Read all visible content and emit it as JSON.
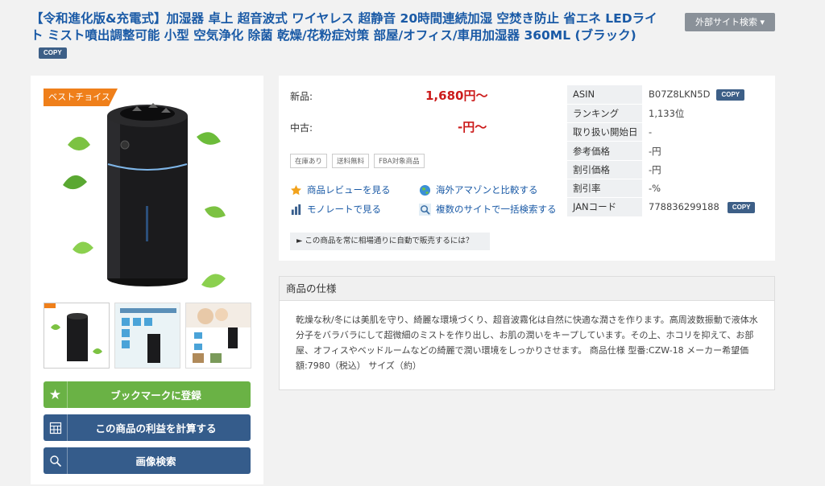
{
  "title": "【令和進化版&充電式】加湿器 卓上 超音波式 ワイヤレス 超静音 20時間連続加湿 空焚き防止 省エネ LEDライト ミスト噴出調整可能 小型 空気浄化 除菌 乾燥/花粉症対策 部屋/オフィス/車用加湿器 360ML (ブラック)",
  "copy_label": "COPY",
  "external_search": "外部サイト検索 ▾",
  "ribbon": "ベストチョイス",
  "buttons": {
    "bookmark": "ブックマークに登録",
    "profit": "この商品の利益を計算する",
    "image_search": "画像検索"
  },
  "price": {
    "new_label": "新品:",
    "new_value": "1,680円〜",
    "used_label": "中古:",
    "used_value": "-円〜"
  },
  "tags": [
    "在庫あり",
    "送料無料",
    "FBA対象商品"
  ],
  "links": {
    "review": "商品レビューを見る",
    "overseas": "海外アマゾンと比較する",
    "monorate": "モノレートで見る",
    "multi_search": "複数のサイトで一括検索する"
  },
  "howto": "►  この商品を常に相場通りに自動で販売するには？",
  "info": [
    {
      "key": "ASIN",
      "value": "B07Z8LKN5D"
    },
    {
      "key": "ランキング",
      "value": "1,133位"
    },
    {
      "key": "取り扱い開始日",
      "value": "-"
    },
    {
      "key": "参考価格",
      "value": "-円"
    },
    {
      "key": "割引価格",
      "value": "-円"
    },
    {
      "key": "割引率",
      "value": "-%"
    },
    {
      "key": "JANコード",
      "value": "778836299188"
    }
  ],
  "spec": {
    "heading": "商品の仕様",
    "body": "乾燥な秋/冬には美肌を守り、綺麗な環境づくり、超音波霧化は自然に快適な潤さを作ります。高周波数振動で液体水分子をバラバラにして超微細のミストを作り出し、お肌の潤いをキープしています。その上、ホコリを抑えて、お部屋、オフィスやベッドルームなどの綺麗で潤い環境をしっかりさせます。 商品仕様 型番:CZW-18 メーカー希望価額:7980（税込） サイズ（約）"
  },
  "colors": {
    "accent_blue": "#355c8b",
    "accent_green": "#6ab245",
    "price_red": "#cc1b1b",
    "ribbon_orange": "#ef7f1a"
  }
}
